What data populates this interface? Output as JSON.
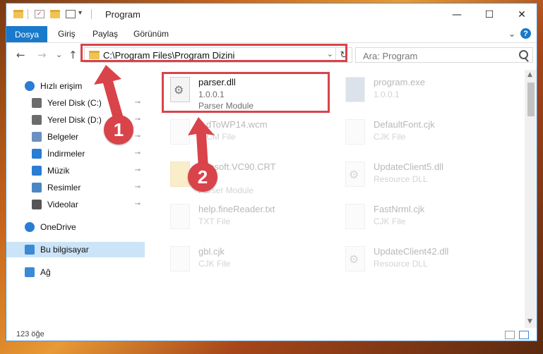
{
  "window": {
    "title": "Program",
    "controls": {
      "minimize": "—",
      "maximize": "☐",
      "close": "✕"
    }
  },
  "ribbon": {
    "tabs": [
      "Dosya",
      "Giriş",
      "Paylaş",
      "Görünüm"
    ],
    "expand_glyph": "⌄",
    "help_glyph": "?"
  },
  "navigation": {
    "back_glyph": "←",
    "forward_glyph": "→",
    "recent_glyph": "⌄",
    "up_glyph": "↑",
    "address_path": "C:\\Program Files\\Program Dizini",
    "address_dropdown_glyph": "⌄",
    "refresh_glyph": "↻",
    "search_placeholder": "Ara: Program"
  },
  "sidebar": {
    "items": [
      {
        "label": "Hızlı erişim",
        "icon": "star-icon",
        "color": "#2b7cd3",
        "pinned": false
      },
      {
        "label": "Yerel Disk (C:)",
        "icon": "drive-icon",
        "color": "#6b6b6b",
        "pinned": true
      },
      {
        "label": "Yerel Disk (D:)",
        "icon": "drive-icon",
        "color": "#6b6b6b",
        "pinned": true
      },
      {
        "label": "Belgeler",
        "icon": "document-icon",
        "color": "#6b8fbf",
        "pinned": true
      },
      {
        "label": "İndirmeler",
        "icon": "download-icon",
        "color": "#2b7cd3",
        "pinned": true
      },
      {
        "label": "Müzik",
        "icon": "music-icon",
        "color": "#2b7cd3",
        "pinned": true
      },
      {
        "label": "Resimler",
        "icon": "picture-icon",
        "color": "#4a86c5",
        "pinned": true
      },
      {
        "label": "Videolar",
        "icon": "video-icon",
        "color": "#555555",
        "pinned": true
      },
      {
        "label": "OneDrive",
        "icon": "cloud-icon",
        "color": "#2b7cd3",
        "pinned": false
      },
      {
        "label": "Bu bilgisayar",
        "icon": "computer-icon",
        "color": "#3b8ad6",
        "pinned": false,
        "selected": true
      },
      {
        "label": "Ağ",
        "icon": "network-icon",
        "color": "#3b8ad6",
        "pinned": false
      }
    ],
    "pin_glyph": "📌"
  },
  "files": [
    {
      "name": "parser.dll",
      "version": "1.0.0.1",
      "type": "Parser Module",
      "icon": "dll-gear-icon",
      "highlighted": true
    },
    {
      "name": "program.exe",
      "version": "1.0.0.1",
      "type": "",
      "icon": "exe-icon",
      "highlighted": false
    },
    {
      "name": "...dToWP14.wcm",
      "version": "WCM File",
      "type": "",
      "icon": "file-icon",
      "highlighted": false
    },
    {
      "name": "DefaultFont.cjk",
      "version": "CJK File",
      "type": "",
      "icon": "file-icon",
      "highlighted": false
    },
    {
      "name": "...rosoft.VC90.CRT",
      "version": "",
      "type": "Parser Module",
      "icon": "folder-icon",
      "highlighted": false
    },
    {
      "name": "UpdateClient5.dll",
      "version": "Resource DLL",
      "type": "",
      "icon": "dll-gear-icon",
      "highlighted": false
    },
    {
      "name": "help.fineReader.txt",
      "version": "TXT File",
      "type": "",
      "icon": "file-icon",
      "highlighted": false
    },
    {
      "name": "FastNrml.cjk",
      "version": "CJK File",
      "type": "",
      "icon": "file-icon",
      "highlighted": false
    },
    {
      "name": "gbl.cjk",
      "version": "CJK File",
      "type": "",
      "icon": "file-icon",
      "highlighted": false
    },
    {
      "name": "UpdateClient42.dll",
      "version": "Resource DLL",
      "type": "",
      "icon": "dll-gear-icon",
      "highlighted": false
    }
  ],
  "status": {
    "item_count": "123 öğe"
  },
  "annotations": {
    "callout_1": "1",
    "callout_2": "2",
    "color": "#d9434a"
  }
}
